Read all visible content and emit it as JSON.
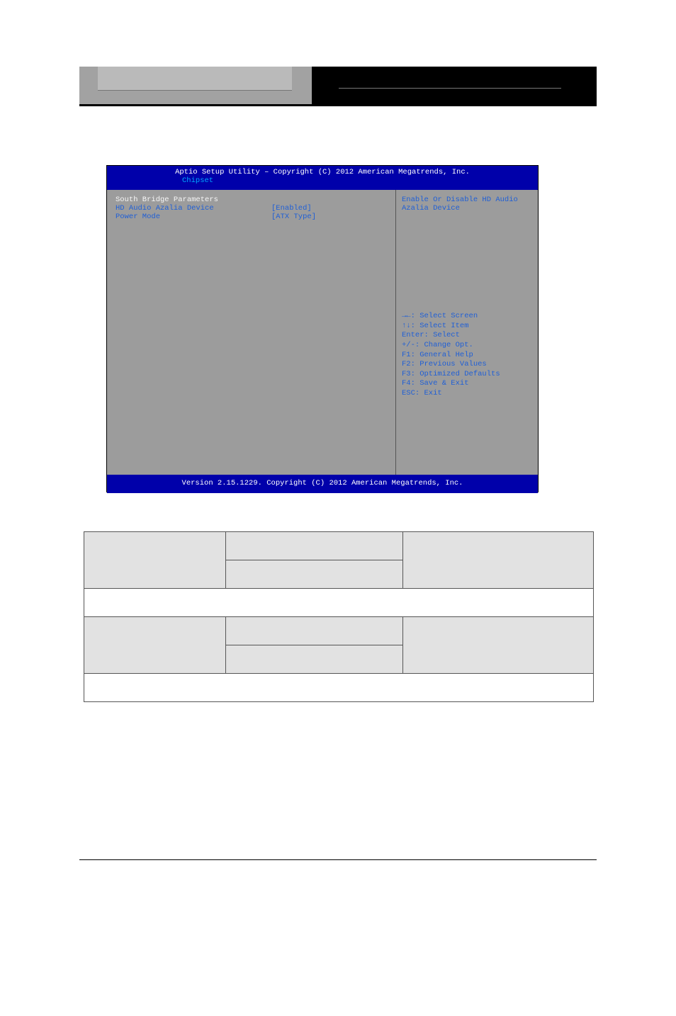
{
  "bios": {
    "title_line": "Aptio Setup Utility – Copyright (C) 2012 American Megatrends, Inc.",
    "tab": "Chipset",
    "section": "South Bridge Parameters",
    "items": [
      {
        "label": "HD Audio Azalia Device",
        "value": "[Enabled]"
      },
      {
        "label": "",
        "value": ""
      },
      {
        "label": "Power Mode",
        "value": "[ATX Type]"
      }
    ],
    "help_desc_l1": "Enable Or Disable HD Audio",
    "help_desc_l2": "Azalia Device",
    "keys": [
      "→←: Select Screen",
      "↑↓: Select Item",
      "Enter: Select",
      "+/-: Change Opt.",
      "F1: General Help",
      "F2: Previous Values",
      "F3: Optimized Defaults",
      "F4: Save & Exit",
      "ESC: Exit"
    ],
    "footer": "Version 2.15.1229. Copyright (C) 2012 American Megatrends, Inc."
  },
  "table": {
    "r1c1": "",
    "r1c2": "",
    "r1c3": "",
    "r2c2": "",
    "r3_full": "",
    "r4c1": "",
    "r4c2": "",
    "r4c3": "",
    "r5c2": "",
    "r6_full": ""
  }
}
